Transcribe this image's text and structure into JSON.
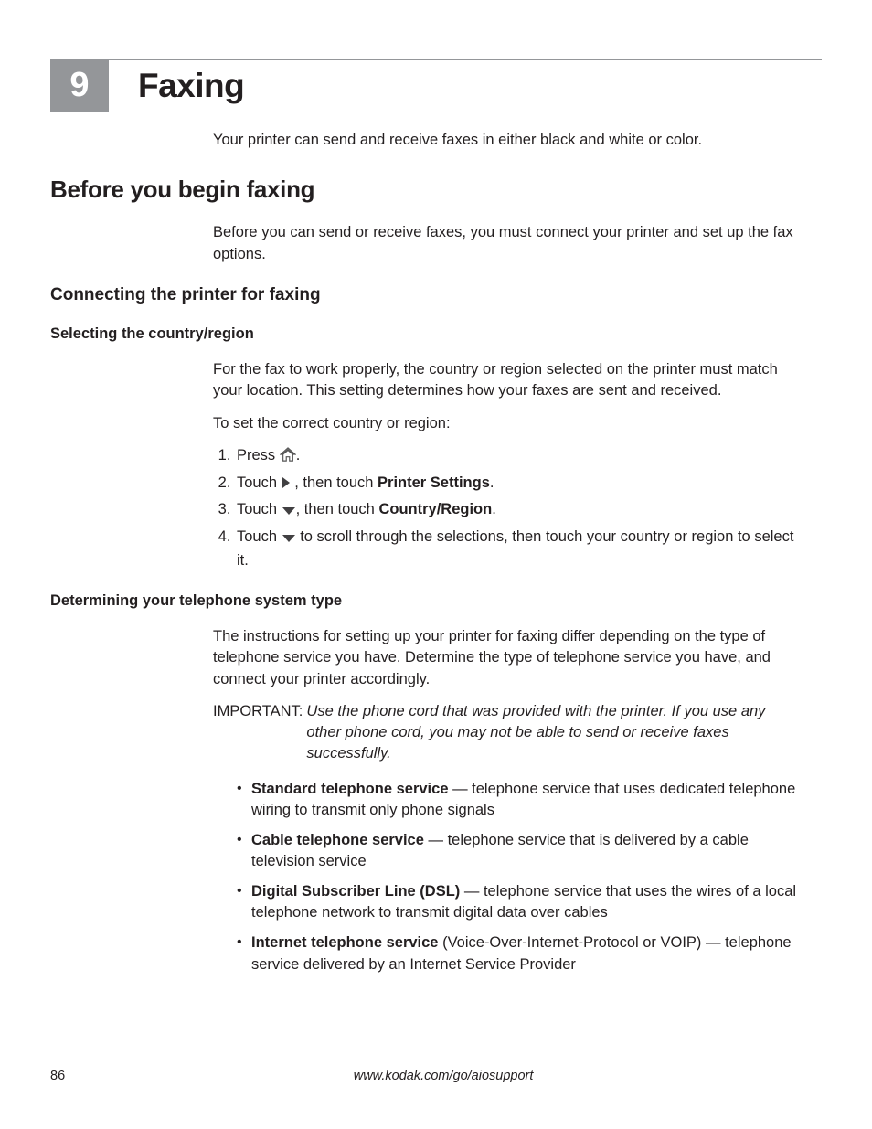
{
  "chapter": {
    "number": "9",
    "title": "Faxing"
  },
  "intro": "Your printer can send and receive faxes in either black and white or color.",
  "section": {
    "heading": "Before you begin faxing",
    "para": "Before you can send or receive faxes, you must connect your printer and set up the fax options."
  },
  "connecting": {
    "heading": "Connecting the printer for faxing"
  },
  "selecting": {
    "heading": "Selecting the country/region",
    "para1": "For the fax to work properly, the country or region selected on the printer must match your location. This setting determines how your faxes are sent and received.",
    "para2": "To set the correct country or region:",
    "steps": {
      "s1_pre": "Press ",
      "s1_post": ".",
      "s2_pre": "Touch ",
      "s2_mid": " , then touch ",
      "s2_bold": "Printer Settings",
      "s2_post": ".",
      "s3_pre": "Touch ",
      "s3_mid": ", then touch ",
      "s3_bold": "Country/Region",
      "s3_post": ".",
      "s4_pre": "Touch ",
      "s4_post": " to scroll through the selections, then touch your country or region to select it."
    }
  },
  "determining": {
    "heading": "Determining your telephone system type",
    "para": "The instructions for setting up your printer for faxing differ depending on the type of telephone service you have. Determine the type of telephone service you have, and connect your printer accordingly.",
    "important_label": "IMPORTANT:",
    "important_text": "Use the phone cord that was provided with the printer. If you use any other phone cord, you may not be able to send or receive faxes successfully.",
    "bullets": {
      "b1_bold": "Standard telephone service",
      "b1_rest": " — telephone service that uses dedicated telephone wiring to transmit only phone signals",
      "b2_bold": "Cable telephone service",
      "b2_rest": " — telephone service that is delivered by a cable television service",
      "b3_bold": "Digital Subscriber Line (DSL)",
      "b3_rest": " — telephone service that uses the wires of a local telephone network to transmit digital data over cables",
      "b4_bold": "Internet telephone service",
      "b4_rest": " (Voice-Over-Internet-Protocol or VOIP) — telephone service delivered by an Internet Service Provider"
    }
  },
  "footer": {
    "page": "86",
    "url": "www.kodak.com/go/aiosupport"
  }
}
